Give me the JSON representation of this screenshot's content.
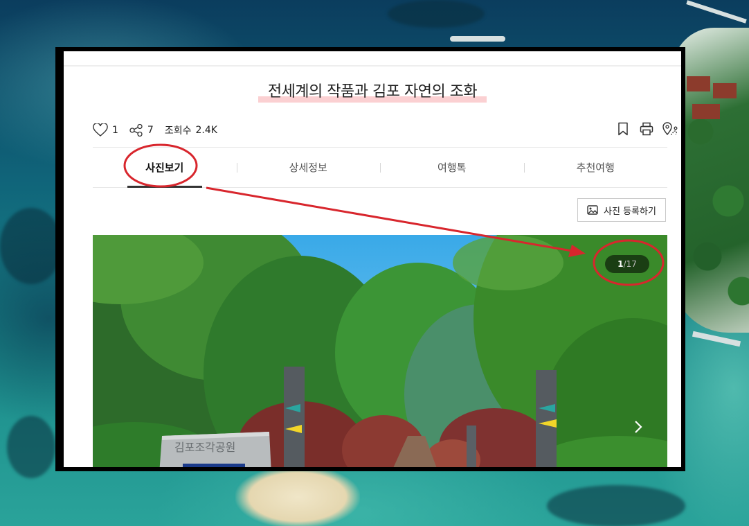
{
  "colors": {
    "annotation_red": "#d8262d",
    "title_highlight": "#fbd0d2",
    "active_tab_underline": "#333333"
  },
  "content": {
    "title": "전세계의 작품과 김포 자연의 조화",
    "stats": {
      "likes": "1",
      "shares": "7",
      "views_label": "조회수",
      "views_value": "2.4K"
    },
    "actions": [
      "bookmark-icon",
      "print-icon",
      "map-location-icon"
    ],
    "tabs": [
      {
        "label": "사진보기",
        "active": true
      },
      {
        "label": "상세정보",
        "active": false
      },
      {
        "label": "여행톡",
        "active": false
      },
      {
        "label": "추천여행",
        "active": false
      }
    ],
    "register_photo_label": "사진 등록하기",
    "gallery": {
      "current": "1",
      "separator": "/",
      "total": "17",
      "sign_text": "김포조각공원"
    }
  }
}
